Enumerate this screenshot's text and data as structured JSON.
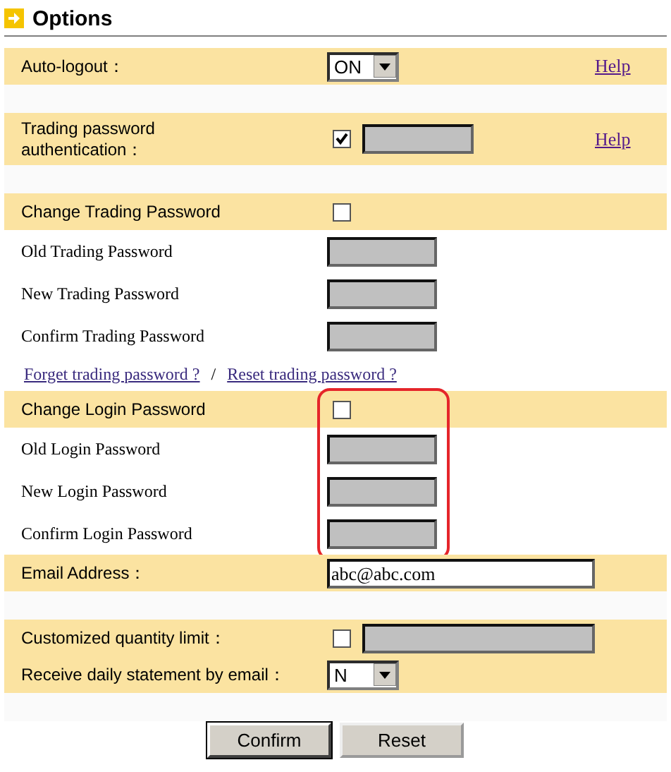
{
  "title": "Options",
  "sections": [
    {
      "highlighted": false,
      "rows": [
        {
          "kind": "select",
          "label": "Auto-logout：",
          "value": "ON",
          "help": "Help"
        },
        {
          "kind": "gap"
        },
        {
          "kind": "check-field",
          "label": "Trading password authentication：",
          "checked": true,
          "help": "Help"
        },
        {
          "kind": "gap"
        },
        {
          "kind": "check",
          "label": "Change Trading Password",
          "checked": false
        },
        {
          "kind": "password",
          "label": "Old Trading Password"
        },
        {
          "kind": "password",
          "label": "New Trading Password"
        },
        {
          "kind": "password",
          "label": "Confirm Trading Password"
        },
        {
          "kind": "links",
          "links": [
            "Forget trading password ?",
            "Reset trading password ?"
          ],
          "separator": "/"
        }
      ]
    },
    {
      "highlighted": true,
      "rows": [
        {
          "kind": "check",
          "label": "Change Login Password",
          "checked": false
        },
        {
          "kind": "password",
          "label": "Old Login Password"
        },
        {
          "kind": "password",
          "label": "New Login Password"
        },
        {
          "kind": "password",
          "label": "Confirm Login Password"
        }
      ]
    },
    {
      "highlighted": false,
      "rows": [
        {
          "kind": "text",
          "label": "Email Address：",
          "value": "abc@abc.com"
        },
        {
          "kind": "gap"
        },
        {
          "kind": "check-wide",
          "label": "Customized quantity limit：",
          "checked": false
        },
        {
          "kind": "select",
          "label": "Receive daily statement by email：",
          "value": "N"
        },
        {
          "kind": "gap"
        }
      ]
    }
  ],
  "buttons": [
    "Confirm",
    "Reset"
  ]
}
